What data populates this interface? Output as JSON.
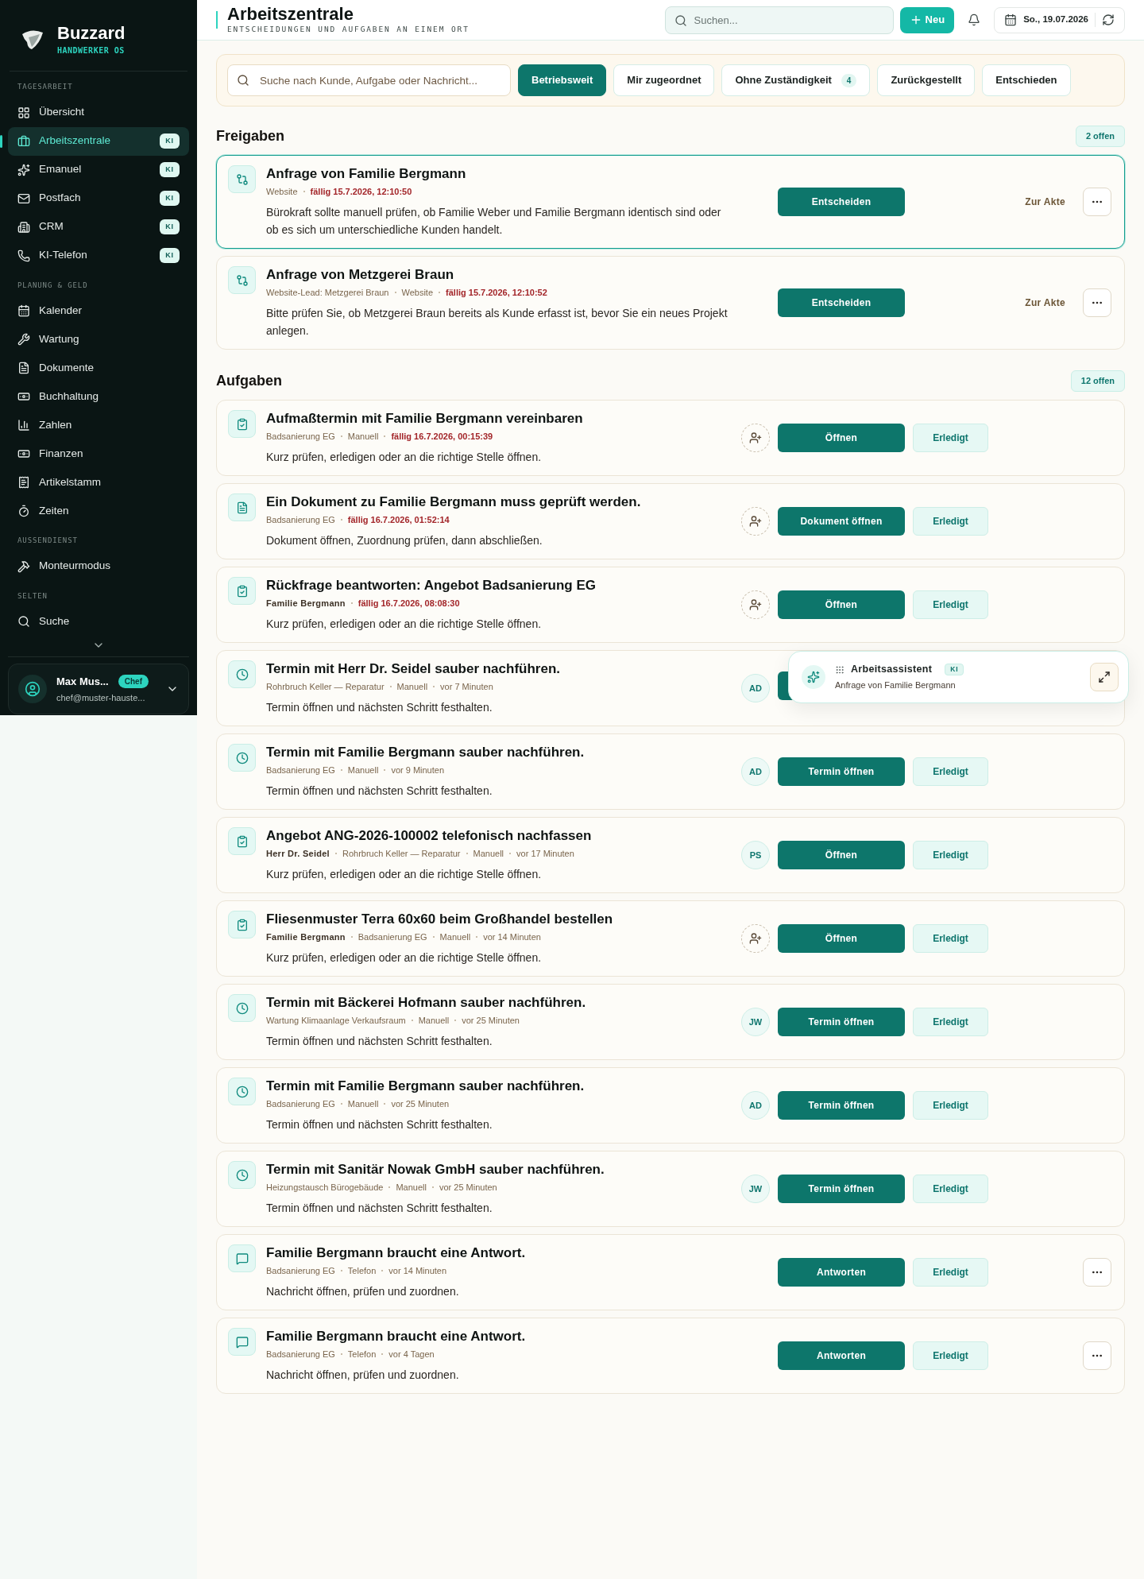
{
  "brand": {
    "name": "Buzzard",
    "subtitle": "HANDWERKER OS"
  },
  "sidebar": {
    "sections": [
      {
        "label": "TAGESARBEIT",
        "items": [
          {
            "label": "Übersicht",
            "selected": false
          },
          {
            "label": "Arbeitszentrale",
            "badge": "KI",
            "selected": true
          },
          {
            "label": "Emanuel",
            "badge": "KI",
            "selected": false
          },
          {
            "label": "Postfach",
            "badge": "KI",
            "selected": false
          },
          {
            "label": "CRM",
            "badge": "KI",
            "selected": false
          },
          {
            "label": "KI-Telefon",
            "badge": "KI",
            "selected": false
          }
        ]
      },
      {
        "label": "PLANUNG & GELD",
        "items": [
          {
            "label": "Kalender",
            "selected": false
          },
          {
            "label": "Wartung",
            "selected": false
          },
          {
            "label": "Dokumente",
            "selected": false
          },
          {
            "label": "Buchhaltung",
            "selected": false
          },
          {
            "label": "Zahlen",
            "selected": false
          },
          {
            "label": "Finanzen",
            "selected": false
          },
          {
            "label": "Artikelstamm",
            "selected": false
          },
          {
            "label": "Zeiten",
            "selected": false
          }
        ]
      },
      {
        "label": "AUSSENDIENST",
        "items": [
          {
            "label": "Monteurmodus",
            "selected": false
          }
        ]
      },
      {
        "label": "SELTEN",
        "items": [
          {
            "label": "Suche",
            "selected": false
          }
        ]
      }
    ],
    "user": {
      "name": "Max Mus...",
      "role": "Chef",
      "email": "chef@muster-hauste..."
    }
  },
  "header": {
    "title": "Arbeitszentrale",
    "subtitle": "ENTSCHEIDUNGEN UND AUFGABEN AN EINEM ORT",
    "search": {
      "placeholder": "Suchen..."
    },
    "new_button": "Neu",
    "date": "So., 19.07.2026"
  },
  "filters": {
    "search": {
      "placeholder": "Suche nach Kunde, Aufgabe oder Nachricht..."
    },
    "tabs": [
      {
        "label": "Betriebsweit",
        "selected": true
      },
      {
        "label": "Mir zugeordnet",
        "selected": false
      },
      {
        "label": "Ohne Zuständigkeit",
        "count": "4",
        "selected": false
      },
      {
        "label": "Zurückgestellt",
        "selected": false
      },
      {
        "label": "Entschieden",
        "selected": false
      }
    ]
  },
  "sections": [
    {
      "title": "Freigaben",
      "count": "2 offen",
      "cards": [
        {
          "kind": "approval",
          "highlighted": true,
          "title": "Anfrage von Familie Bergmann",
          "meta": [
            {
              "kind": "plain",
              "text": "Website"
            },
            {
              "kind": "due",
              "text": "fällig 15.7.2026, 12:10:50"
            }
          ],
          "text": "Bürokraft sollte manuell prüfen, ob Familie Weber und Familie Bergmann identisch sind oder ob es sich um unterschiedliche Kunden handelt.",
          "actions": [
            {
              "kind": "primary",
              "label": "Entscheiden"
            },
            {
              "kind": "link",
              "label": "Zur Akte"
            },
            {
              "kind": "more"
            }
          ]
        },
        {
          "kind": "approval",
          "highlighted": false,
          "title": "Anfrage von Metzgerei Braun",
          "meta": [
            {
              "kind": "plain",
              "text": "Website-Lead: Metzgerei Braun"
            },
            {
              "kind": "plain",
              "text": "Website"
            },
            {
              "kind": "due",
              "text": "fällig 15.7.2026, 12:10:52"
            }
          ],
          "text": "Bitte prüfen Sie, ob Metzgerei Braun bereits als Kunde erfasst ist, bevor Sie ein neues Projekt anlegen.",
          "actions": [
            {
              "kind": "primary",
              "label": "Entscheiden"
            },
            {
              "kind": "link",
              "label": "Zur Akte"
            },
            {
              "kind": "more"
            }
          ]
        }
      ]
    },
    {
      "title": "Aufgaben",
      "count": "12 offen",
      "cards": [
        {
          "kind": "task",
          "highlighted": false,
          "title": "Aufmaßtermin mit Familie Bergmann vereinbaren",
          "meta": [
            {
              "kind": "plain",
              "text": "Badsanierung EG"
            },
            {
              "kind": "plain",
              "text": "Manuell"
            },
            {
              "kind": "due",
              "text": "fällig 16.7.2026, 00:15:39"
            }
          ],
          "text": "Kurz prüfen, erledigen oder an die richtige Stelle öffnen.",
          "assignee": {
            "kind": "add"
          },
          "actions": [
            {
              "kind": "primary",
              "label": "Öffnen"
            },
            {
              "kind": "done",
              "label": "Erledigt"
            }
          ]
        },
        {
          "kind": "document",
          "highlighted": false,
          "title": "Ein Dokument zu Familie Bergmann muss geprüft werden.",
          "meta": [
            {
              "kind": "plain",
              "text": "Badsanierung EG"
            },
            {
              "kind": "due",
              "text": "fällig 16.7.2026, 01:52:14"
            }
          ],
          "text": "Dokument öffnen, Zuordnung prüfen, dann abschließen.",
          "assignee": {
            "kind": "add"
          },
          "actions": [
            {
              "kind": "primary",
              "label": "Dokument öffnen"
            },
            {
              "kind": "done",
              "label": "Erledigt"
            }
          ]
        },
        {
          "kind": "task",
          "highlighted": false,
          "title": "Rückfrage beantworten: Angebot Badsanierung EG",
          "meta": [
            {
              "kind": "strong",
              "text": "Familie Bergmann"
            },
            {
              "kind": "due",
              "text": "fällig 16.7.2026, 08:08:30"
            }
          ],
          "text": "Kurz prüfen, erledigen oder an die richtige Stelle öffnen.",
          "assignee": {
            "kind": "add"
          },
          "actions": [
            {
              "kind": "primary",
              "label": "Öffnen"
            },
            {
              "kind": "done",
              "label": "Erledigt"
            }
          ]
        },
        {
          "kind": "appointment",
          "highlighted": false,
          "title": "Termin mit Herr Dr. Seidel sauber nachführen.",
          "meta": [
            {
              "kind": "plain",
              "text": "Rohrbruch Keller — Reparatur"
            },
            {
              "kind": "plain",
              "text": "Manuell"
            },
            {
              "kind": "plain",
              "text": "vor 7 Minuten"
            }
          ],
          "text": "Termin öffnen und nächsten Schritt festhalten.",
          "assignee": {
            "kind": "initials",
            "text": "AD"
          },
          "actions": [
            {
              "kind": "primary"
            }
          ]
        },
        {
          "kind": "appointment",
          "highlighted": false,
          "title": "Termin mit Familie Bergmann sauber nachführen.",
          "meta": [
            {
              "kind": "plain",
              "text": "Badsanierung EG"
            },
            {
              "kind": "plain",
              "text": "Manuell"
            },
            {
              "kind": "plain",
              "text": "vor 9 Minuten"
            }
          ],
          "text": "Termin öffnen und nächsten Schritt festhalten.",
          "assignee": {
            "kind": "initials",
            "text": "AD"
          },
          "actions": [
            {
              "kind": "primary",
              "label": "Termin öffnen"
            },
            {
              "kind": "done",
              "label": "Erledigt"
            }
          ]
        },
        {
          "kind": "task",
          "highlighted": false,
          "title": "Angebot ANG-2026-100002 telefonisch nachfassen",
          "meta": [
            {
              "kind": "strong",
              "text": "Herr Dr. Seidel"
            },
            {
              "kind": "plain",
              "text": "Rohrbruch Keller — Reparatur"
            },
            {
              "kind": "plain",
              "text": "Manuell"
            },
            {
              "kind": "plain",
              "text": "vor 17 Minuten"
            }
          ],
          "text": "Kurz prüfen, erledigen oder an die richtige Stelle öffnen.",
          "assignee": {
            "kind": "initials",
            "text": "PS"
          },
          "actions": [
            {
              "kind": "primary",
              "label": "Öffnen"
            },
            {
              "kind": "done",
              "label": "Erledigt"
            }
          ]
        },
        {
          "kind": "task",
          "highlighted": false,
          "title": "Fliesenmuster Terra 60x60 beim Großhandel bestellen",
          "meta": [
            {
              "kind": "strong",
              "text": "Familie Bergmann"
            },
            {
              "kind": "plain",
              "text": "Badsanierung EG"
            },
            {
              "kind": "plain",
              "text": "Manuell"
            },
            {
              "kind": "plain",
              "text": "vor 14 Minuten"
            }
          ],
          "text": "Kurz prüfen, erledigen oder an die richtige Stelle öffnen.",
          "assignee": {
            "kind": "add"
          },
          "actions": [
            {
              "kind": "primary",
              "label": "Öffnen"
            },
            {
              "kind": "done",
              "label": "Erledigt"
            }
          ]
        },
        {
          "kind": "appointment",
          "highlighted": false,
          "title": "Termin mit Bäckerei Hofmann sauber nachführen.",
          "meta": [
            {
              "kind": "plain",
              "text": "Wartung Klimaanlage Verkaufsraum"
            },
            {
              "kind": "plain",
              "text": "Manuell"
            },
            {
              "kind": "plain",
              "text": "vor 25 Minuten"
            }
          ],
          "text": "Termin öffnen und nächsten Schritt festhalten.",
          "assignee": {
            "kind": "initials",
            "text": "JW"
          },
          "actions": [
            {
              "kind": "primary",
              "label": "Termin öffnen"
            },
            {
              "kind": "done",
              "label": "Erledigt"
            }
          ]
        },
        {
          "kind": "appointment",
          "highlighted": false,
          "title": "Termin mit Familie Bergmann sauber nachführen.",
          "meta": [
            {
              "kind": "plain",
              "text": "Badsanierung EG"
            },
            {
              "kind": "plain",
              "text": "Manuell"
            },
            {
              "kind": "plain",
              "text": "vor 25 Minuten"
            }
          ],
          "text": "Termin öffnen und nächsten Schritt festhalten.",
          "assignee": {
            "kind": "initials",
            "text": "AD"
          },
          "actions": [
            {
              "kind": "primary",
              "label": "Termin öffnen"
            },
            {
              "kind": "done",
              "label": "Erledigt"
            }
          ]
        },
        {
          "kind": "appointment",
          "highlighted": false,
          "title": "Termin mit Sanitär Nowak GmbH sauber nachführen.",
          "meta": [
            {
              "kind": "plain",
              "text": "Heizungstausch Bürogebäude"
            },
            {
              "kind": "plain",
              "text": "Manuell"
            },
            {
              "kind": "plain",
              "text": "vor 25 Minuten"
            }
          ],
          "text": "Termin öffnen und nächsten Schritt festhalten.",
          "assignee": {
            "kind": "initials",
            "text": "JW"
          },
          "actions": [
            {
              "kind": "primary",
              "label": "Termin öffnen"
            },
            {
              "kind": "done",
              "label": "Erledigt"
            }
          ]
        },
        {
          "kind": "message",
          "highlighted": false,
          "title": "Familie Bergmann braucht eine Antwort.",
          "meta": [
            {
              "kind": "plain",
              "text": "Badsanierung EG"
            },
            {
              "kind": "plain",
              "text": "Telefon"
            },
            {
              "kind": "plain",
              "text": "vor 14 Minuten"
            }
          ],
          "text": "Nachricht öffnen, prüfen und zuordnen.",
          "actions": [
            {
              "kind": "primary",
              "label": "Antworten"
            },
            {
              "kind": "done",
              "label": "Erledigt"
            },
            {
              "kind": "more"
            }
          ]
        },
        {
          "kind": "message",
          "highlighted": false,
          "title": "Familie Bergmann braucht eine Antwort.",
          "meta": [
            {
              "kind": "plain",
              "text": "Badsanierung EG"
            },
            {
              "kind": "plain",
              "text": "Telefon"
            },
            {
              "kind": "plain",
              "text": "vor 4 Tagen"
            }
          ],
          "text": "Nachricht öffnen, prüfen und zuordnen.",
          "actions": [
            {
              "kind": "primary",
              "label": "Antworten"
            },
            {
              "kind": "done",
              "label": "Erledigt"
            },
            {
              "kind": "more"
            }
          ]
        }
      ]
    }
  ],
  "assistant": {
    "title": "Arbeitsassistent",
    "badge": "KI",
    "subtitle": "Anfrage von Familie Bergmann"
  }
}
